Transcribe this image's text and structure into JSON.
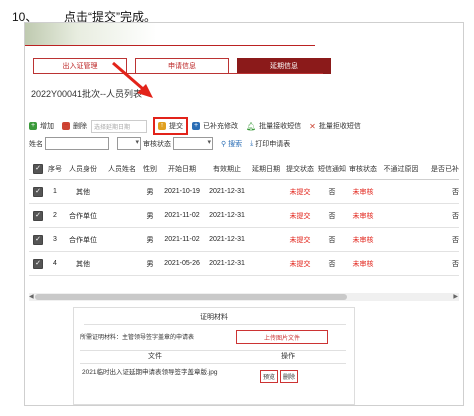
{
  "step": {
    "number": "10、",
    "text": "点击“提交”完成。"
  },
  "tabs": [
    {
      "label": "出入证管理",
      "active": false
    },
    {
      "label": "申请信息",
      "active": false
    },
    {
      "label": "延期信息",
      "active": true
    }
  ],
  "list_title": "2022Y00041批次--人员列表",
  "toolbar": {
    "add": "增加",
    "delete": "删除",
    "date_placeholder": "选择延期日期",
    "submit": "提交",
    "supplement": "已补充修改",
    "batch_sms": "批量接收短信",
    "batch_reject_sms": "批量拒收短信"
  },
  "filter": {
    "name_label": "姓名",
    "review_status_placeholder": "审核状态",
    "search": "搜索",
    "print": "打印申请表"
  },
  "table": {
    "headers": [
      "序号",
      "人员身份",
      "人员姓名",
      "性别",
      "开始日期",
      "有效期止",
      "延期日期",
      "提交状态",
      "短信通知",
      "审核状态",
      "不通过原因",
      "是否已补"
    ],
    "rows": [
      [
        "1",
        "其他",
        "",
        "男",
        "2021-10-19",
        "2021-12-31",
        "",
        "未提交",
        "否",
        "未审核",
        "",
        "否"
      ],
      [
        "2",
        "合作单位",
        "",
        "男",
        "2021-11-02",
        "2021-12-31",
        "",
        "未提交",
        "否",
        "未审核",
        "",
        "否"
      ],
      [
        "3",
        "合作单位",
        "",
        "男",
        "2021-11-02",
        "2021-12-31",
        "",
        "未提交",
        "否",
        "未审核",
        "",
        "否"
      ],
      [
        "4",
        "其他",
        "",
        "男",
        "2021-05-26",
        "2021-12-31",
        "",
        "未提交",
        "否",
        "未审核",
        "",
        "否"
      ]
    ]
  },
  "proof": {
    "title": "证明材料",
    "required_label": "所需证明材料：主管领导签字盖章的申请表",
    "upload": "上传图片文件",
    "col_file": "文件",
    "col_ops": "操作",
    "file_name": "2021临时出入证延期申请表领导签字盖章版.jpg",
    "preview": "预览",
    "remove": "删除"
  },
  "colors": {
    "brand_red": "#8b1a1a",
    "accent_red": "#e2231a",
    "status_red": "#e2231a"
  }
}
